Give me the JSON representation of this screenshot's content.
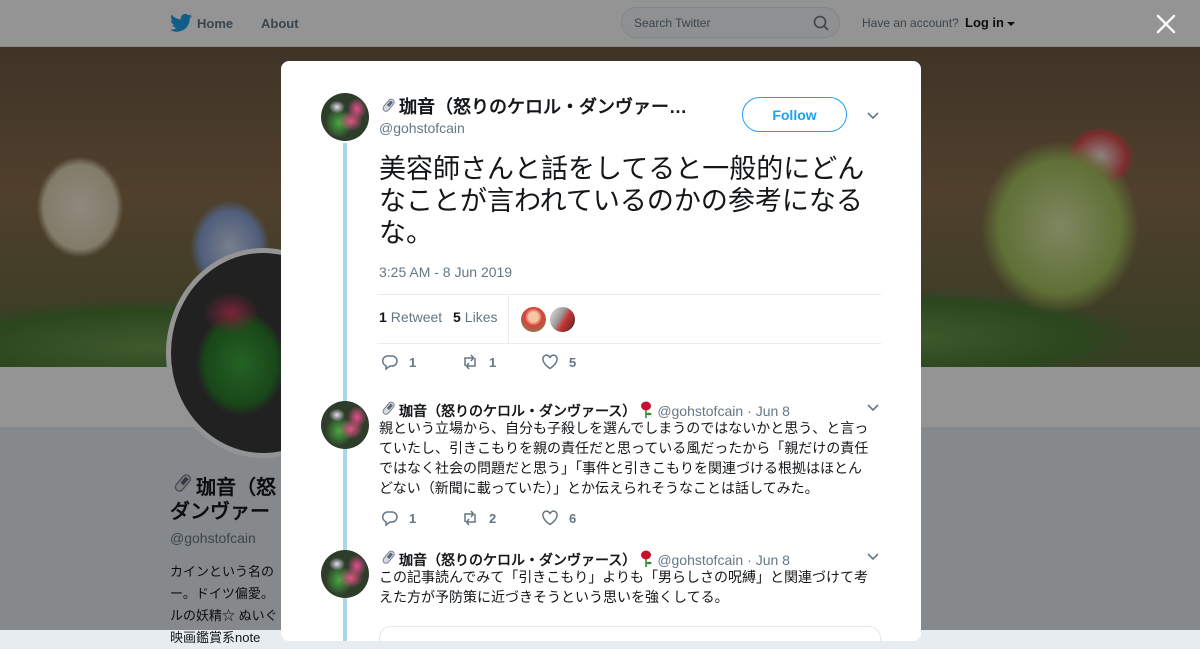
{
  "nav": {
    "home": "Home",
    "about": "About",
    "search_placeholder": "Search Twitter",
    "account_question": "Have an account?",
    "login": "Log in"
  },
  "profile": {
    "name_line1": "珈音（怒",
    "name_line2": "ダンヴァー",
    "handle": "@gohstofcain",
    "bio_lines": [
      "カインという名の",
      "ー。ドイツ偏愛。",
      "ルの妖精☆ ぬいぐ",
      "映画鑑賞系note"
    ]
  },
  "tweet": {
    "author_name": "珈音（怒りのケロル・ダンヴァー…",
    "handle": "@gohstofcain",
    "follow_label": "Follow",
    "text": "美容師さんと話をしてると一般的にどんなことが言われているのかの参考になるな。",
    "timestamp": "3:25 AM - 8 Jun 2019",
    "retweets_count": "1",
    "retweets_label": "Retweet",
    "likes_count": "5",
    "likes_label": "Likes",
    "actions": {
      "reply": "1",
      "retweet": "1",
      "like": "5"
    }
  },
  "replies": [
    {
      "author_name": "珈音（怒りのケロル・ダンヴァース）",
      "handle": "@gohstofcain",
      "date": "· Jun 8",
      "text": "親という立場から、自分も子殺しを選んでしまうのではないかと思う、と言っていたし、引きこもりを親の責任だと思っている風だったから「親だけの責任ではなく社会の問題だと思う」「事件と引きこもりを関連づける根拠はほとんどない（新聞に載っていた）」とか伝えられそうなことは話してみた。",
      "actions": {
        "reply": "1",
        "retweet": "2",
        "like": "6"
      }
    },
    {
      "author_name": "珈音（怒りのケロル・ダンヴァース）",
      "handle": "@gohstofcain",
      "date": "· Jun 8",
      "text": "この記事読んでみて「引きこもり」よりも「男らしさの呪縛」と関連づけて考えた方が予防策に近づきそうという思いを強くしてる。"
    }
  ],
  "colors": {
    "accent": "#1da1f2",
    "thread_line": "#a7d7ea",
    "muted": "#657786",
    "text": "#14171a"
  },
  "icons": [
    "twitter-bird-icon",
    "search-icon",
    "close-icon",
    "chevron-down-icon",
    "reply-icon",
    "retweet-icon",
    "heart-icon",
    "pin-emoji-icon",
    "rose-emoji-icon"
  ]
}
